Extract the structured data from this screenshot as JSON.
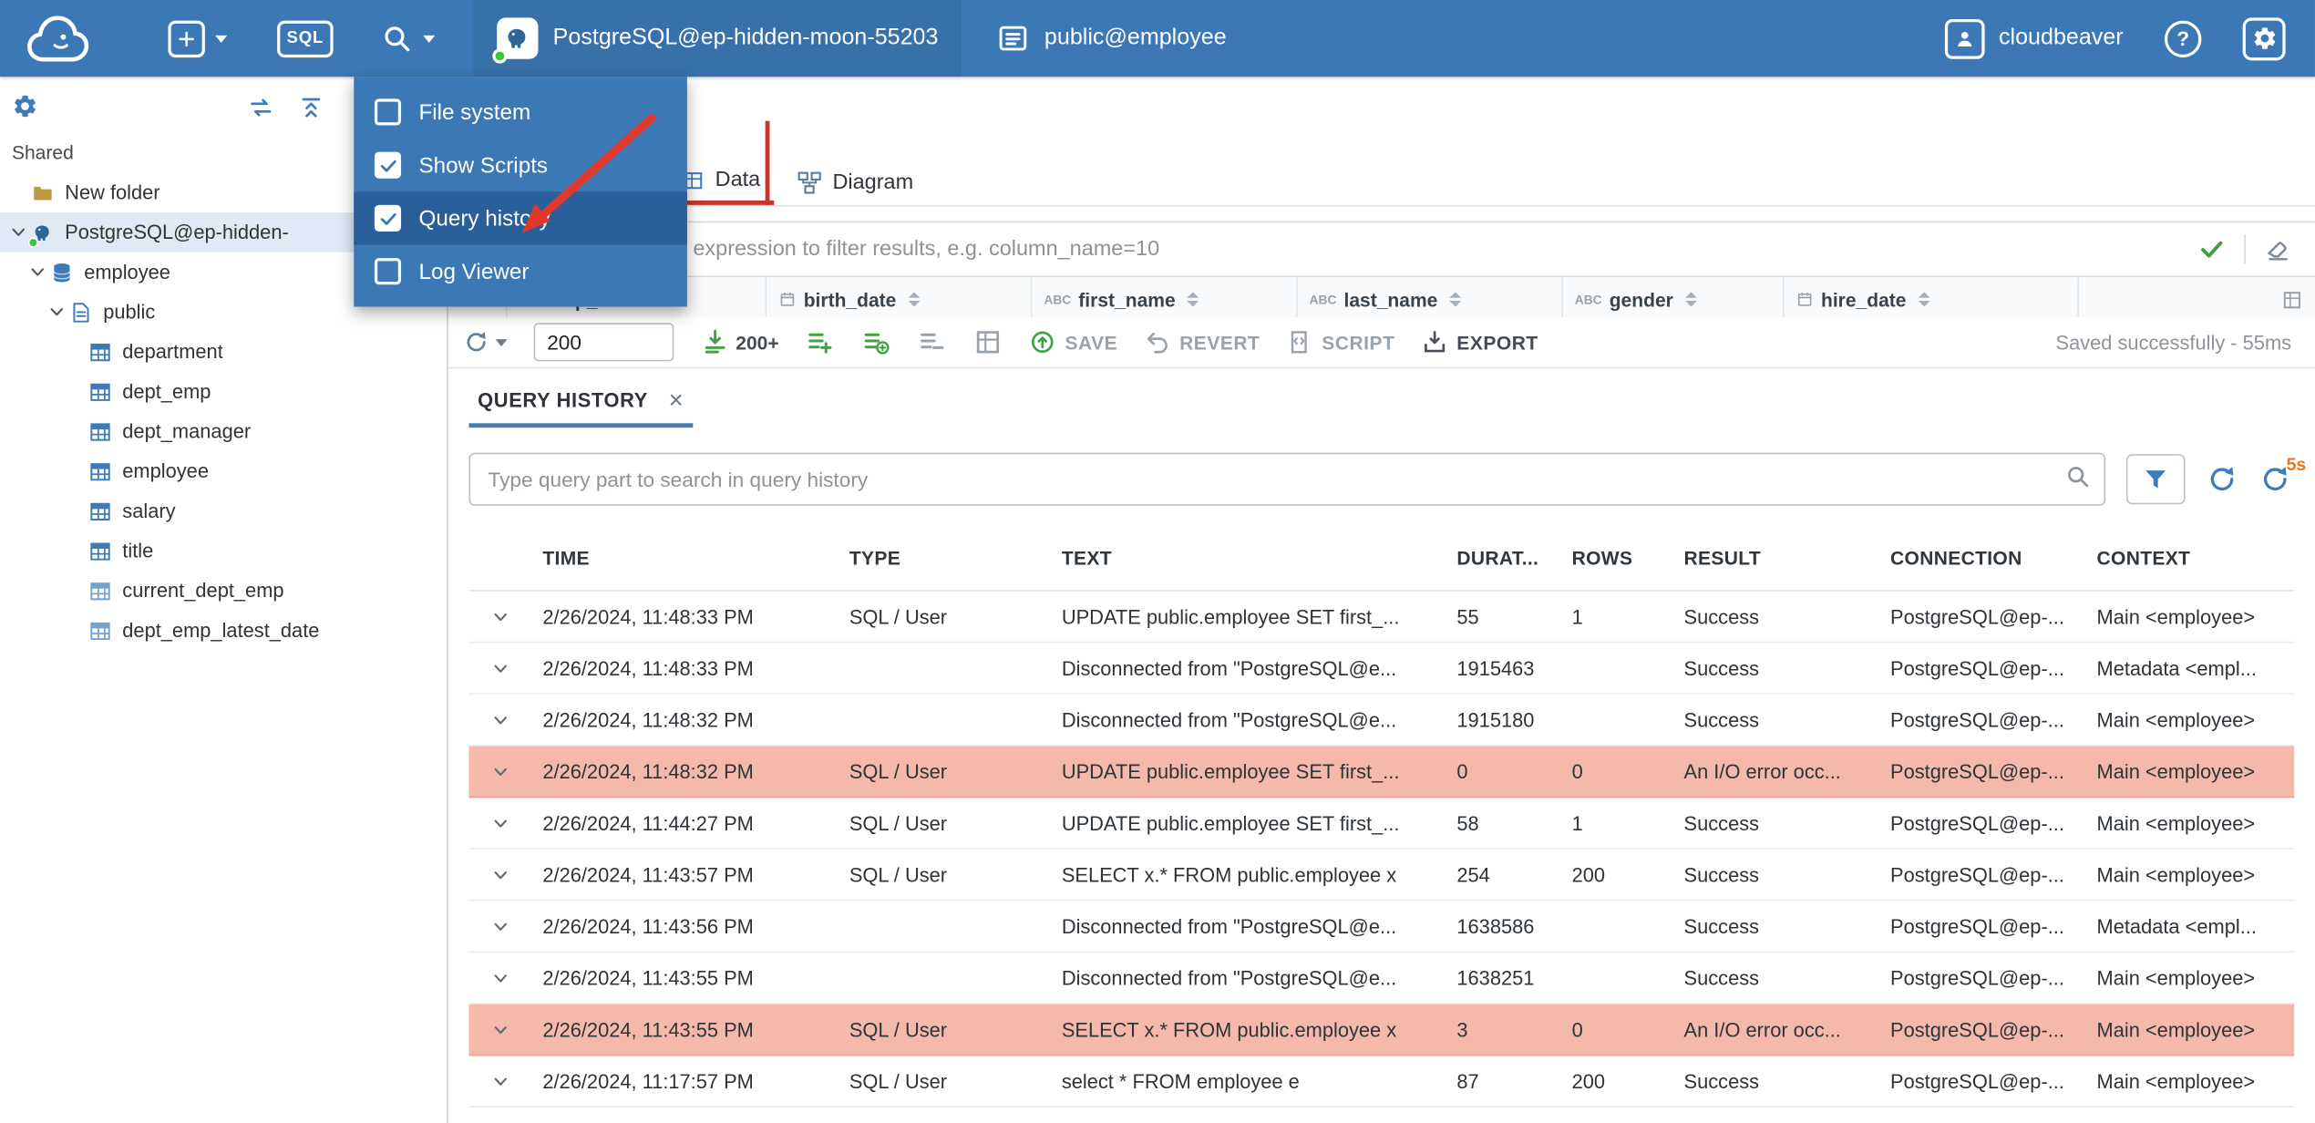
{
  "topbar": {
    "sql_label": "SQL",
    "connection": "PostgreSQL@ep-hidden-moon-55203",
    "schema": "public@employee",
    "user_label": "cloudbeaver"
  },
  "menu": {
    "items": [
      {
        "label": "File system",
        "checked": false,
        "selected": false
      },
      {
        "label": "Show Scripts",
        "checked": true,
        "selected": false
      },
      {
        "label": "Query history",
        "checked": true,
        "selected": true
      },
      {
        "label": "Log Viewer",
        "checked": false,
        "selected": false
      }
    ]
  },
  "sidebar": {
    "section_label": "Shared",
    "tree": [
      {
        "label": "New folder",
        "icon": "folder",
        "depth": 0,
        "chevron": false,
        "selected": false
      },
      {
        "label": "PostgreSQL@ep-hidden-",
        "icon": "postgres",
        "depth": 0,
        "chevron": true,
        "selected": true
      },
      {
        "label": "employee",
        "icon": "database",
        "depth": 1,
        "chevron": true,
        "selected": false
      },
      {
        "label": "public",
        "icon": "schema",
        "depth": 2,
        "chevron": true,
        "selected": false
      },
      {
        "label": "department",
        "icon": "table",
        "depth": 3,
        "chevron": false,
        "selected": false
      },
      {
        "label": "dept_emp",
        "icon": "table",
        "depth": 3,
        "chevron": false,
        "selected": false
      },
      {
        "label": "dept_manager",
        "icon": "table",
        "depth": 3,
        "chevron": false,
        "selected": false
      },
      {
        "label": "employee",
        "icon": "table",
        "depth": 3,
        "chevron": false,
        "selected": false
      },
      {
        "label": "salary",
        "icon": "table",
        "depth": 3,
        "chevron": false,
        "selected": false
      },
      {
        "label": "title",
        "icon": "table",
        "depth": 3,
        "chevron": false,
        "selected": false
      },
      {
        "label": "current_dept_emp",
        "icon": "view",
        "depth": 3,
        "chevron": false,
        "selected": false
      },
      {
        "label": "dept_emp_latest_date",
        "icon": "view",
        "depth": 3,
        "chevron": false,
        "selected": false
      }
    ]
  },
  "editor": {
    "tabs": [
      {
        "label": "Data",
        "active": true
      },
      {
        "label": "Diagram",
        "active": false
      }
    ],
    "filter_placeholder": "expression to filter results, e.g. column_name=10",
    "grid_columns": [
      {
        "type": "number",
        "label": "emp_no"
      },
      {
        "type": "date",
        "label": "birth_date"
      },
      {
        "type": "text",
        "label": "first_name"
      },
      {
        "type": "text",
        "label": "last_name"
      },
      {
        "type": "text",
        "label": "gender"
      },
      {
        "type": "date",
        "label": "hire_date"
      }
    ],
    "toolbar": {
      "row_limit": "200",
      "fetch_label": "200+",
      "save": "SAVE",
      "revert": "REVERT",
      "script": "SCRIPT",
      "export": "EXPORT",
      "status": "Saved successfully - 55ms"
    }
  },
  "history": {
    "tab_label": "QUERY HISTORY",
    "search_placeholder": "Type query part to search in query history",
    "refresh_interval": "5s",
    "columns": [
      "TIME",
      "TYPE",
      "TEXT",
      "DURAT...",
      "ROWS",
      "RESULT",
      "CONNECTION",
      "CONTEXT"
    ],
    "rows": [
      {
        "time": "2/26/2024, 11:48:33 PM",
        "type": "SQL / User",
        "text": "UPDATE public.employee SET first_...",
        "duration": "55",
        "rows": "1",
        "result": "Success",
        "connection": "PostgreSQL@ep-...",
        "context": "Main <employee>",
        "error": false
      },
      {
        "time": "2/26/2024, 11:48:33 PM",
        "type": "",
        "text": "Disconnected from \"PostgreSQL@e...",
        "duration": "1915463",
        "rows": "",
        "result": "Success",
        "connection": "PostgreSQL@ep-...",
        "context": "Metadata <empl...",
        "error": false
      },
      {
        "time": "2/26/2024, 11:48:32 PM",
        "type": "",
        "text": "Disconnected from \"PostgreSQL@e...",
        "duration": "1915180",
        "rows": "",
        "result": "Success",
        "connection": "PostgreSQL@ep-...",
        "context": "Main <employee>",
        "error": false
      },
      {
        "time": "2/26/2024, 11:48:32 PM",
        "type": "SQL / User",
        "text": "UPDATE public.employee SET first_...",
        "duration": "0",
        "rows": "0",
        "result": "An I/O error occ...",
        "connection": "PostgreSQL@ep-...",
        "context": "Main <employee>",
        "error": true
      },
      {
        "time": "2/26/2024, 11:44:27 PM",
        "type": "SQL / User",
        "text": "UPDATE public.employee SET first_...",
        "duration": "58",
        "rows": "1",
        "result": "Success",
        "connection": "PostgreSQL@ep-...",
        "context": "Main <employee>",
        "error": false
      },
      {
        "time": "2/26/2024, 11:43:57 PM",
        "type": "SQL / User",
        "text": "SELECT x.* FROM public.employee x",
        "duration": "254",
        "rows": "200",
        "result": "Success",
        "connection": "PostgreSQL@ep-...",
        "context": "Main <employee>",
        "error": false
      },
      {
        "time": "2/26/2024, 11:43:56 PM",
        "type": "",
        "text": "Disconnected from \"PostgreSQL@e...",
        "duration": "1638586",
        "rows": "",
        "result": "Success",
        "connection": "PostgreSQL@ep-...",
        "context": "Metadata <empl...",
        "error": false
      },
      {
        "time": "2/26/2024, 11:43:55 PM",
        "type": "",
        "text": "Disconnected from \"PostgreSQL@e...",
        "duration": "1638251",
        "rows": "",
        "result": "Success",
        "connection": "PostgreSQL@ep-...",
        "context": "Main <employee>",
        "error": false
      },
      {
        "time": "2/26/2024, 11:43:55 PM",
        "type": "SQL / User",
        "text": "SELECT x.* FROM public.employee x",
        "duration": "3",
        "rows": "0",
        "result": "An I/O error occ...",
        "connection": "PostgreSQL@ep-...",
        "context": "Main <employee>",
        "error": true
      },
      {
        "time": "2/26/2024, 11:17:57 PM",
        "type": "SQL / User",
        "text": "select * FROM employee e",
        "duration": "87",
        "rows": "200",
        "result": "Success",
        "connection": "PostgreSQL@ep-...",
        "context": "Main <employee>",
        "error": false
      }
    ]
  },
  "colors": {
    "topbar_blue": "#3c78b5",
    "menu_selected_blue": "#2b5f9b",
    "error_row_pink": "#f5b9ab",
    "data_tab_accent_red": "#c4372a",
    "history_tab_accent_blue": "#4c7aae",
    "apply_filter_green": "#3fa142",
    "toolbar_green": "#43a047",
    "auto_refresh_orange": "#e8751a",
    "status_dot_green": "#3ec53e"
  }
}
